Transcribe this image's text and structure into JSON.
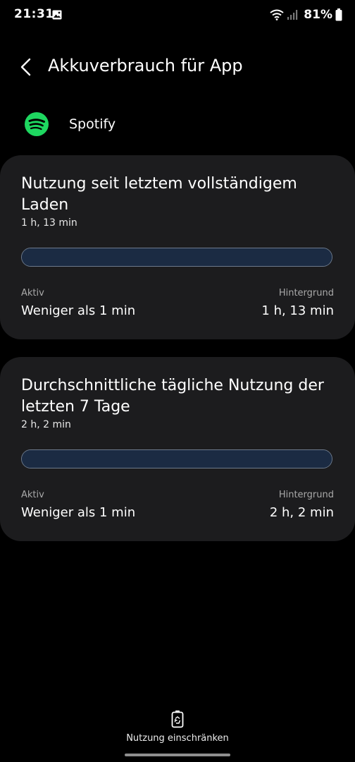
{
  "status_bar": {
    "time": "21:31",
    "battery": "81%",
    "icons": [
      "gallery-icon",
      "wifi-icon",
      "signal-icon",
      "battery-icon"
    ]
  },
  "header": {
    "title": "Akkuverbrauch für App",
    "back_icon": "chevron-left-icon"
  },
  "app": {
    "name": "Spotify",
    "icon": "spotify-logo",
    "brand_color": "#1ed760"
  },
  "cards": [
    {
      "title": "Nutzung seit letztem vollständigem Laden",
      "total": "1 h, 13 min",
      "bar_fill_fraction": 1.0,
      "active_label": "Aktiv",
      "active_value": "Weniger als 1 min",
      "background_label": "Hintergrund",
      "background_value": "1 h, 13 min"
    },
    {
      "title": "Durchschnittliche tägliche Nutzung der letzten 7 Tage",
      "total": "2 h, 2 min",
      "bar_fill_fraction": 1.0,
      "active_label": "Aktiv",
      "active_value": "Weniger als 1 min",
      "background_label": "Hintergrund",
      "background_value": "2 h, 2 min"
    }
  ],
  "bottom_action": {
    "label": "Nutzung einschränken",
    "icon": "battery-restrict-icon"
  },
  "colors": {
    "background": "#000000",
    "card": "#1c1c1e",
    "bar_fill": "#1b2b43",
    "bar_border": "#6d7a8c",
    "secondary_text": "#a9a9a9"
  }
}
